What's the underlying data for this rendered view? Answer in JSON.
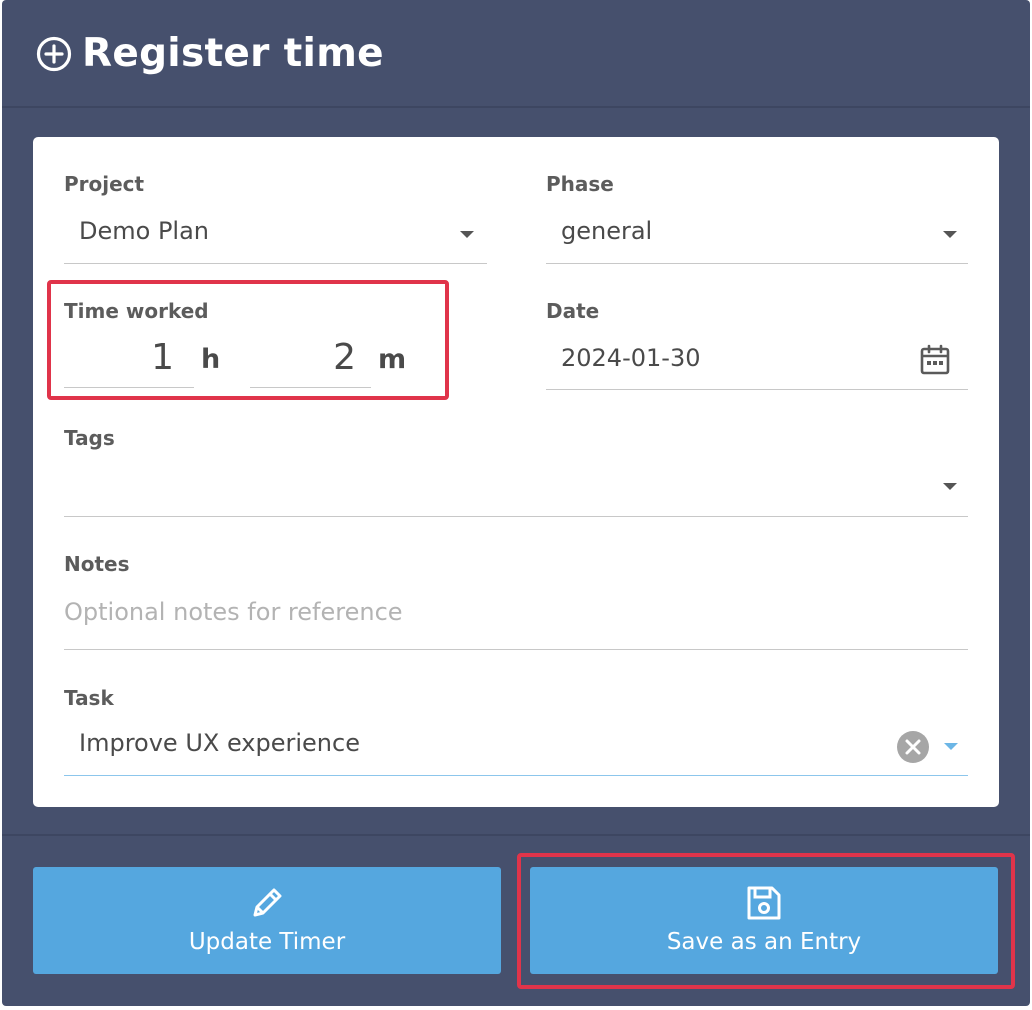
{
  "header": {
    "title": "Register time",
    "icon": "plus-circle-icon"
  },
  "form": {
    "project": {
      "label": "Project",
      "value": "Demo Plan"
    },
    "phase": {
      "label": "Phase",
      "value": "general"
    },
    "time_worked": {
      "label": "Time worked",
      "hours": "1",
      "hours_unit": "h",
      "minutes": "2",
      "minutes_unit": "m"
    },
    "date": {
      "label": "Date",
      "value": "2024-01-30",
      "icon": "calendar-icon"
    },
    "tags": {
      "label": "Tags",
      "value": ""
    },
    "notes": {
      "label": "Notes",
      "placeholder": "Optional notes for reference"
    },
    "task": {
      "label": "Task",
      "value": "Improve UX experience"
    }
  },
  "buttons": {
    "update_timer": {
      "label": "Update Timer",
      "icon": "pencil-icon"
    },
    "save_entry": {
      "label": "Save as an Entry",
      "icon": "floppy-disk-icon"
    }
  },
  "colors": {
    "header_bg": "#46506d",
    "button_bg": "#55a7df",
    "highlight": "#e0344a",
    "task_underline": "#8cc6ec"
  }
}
